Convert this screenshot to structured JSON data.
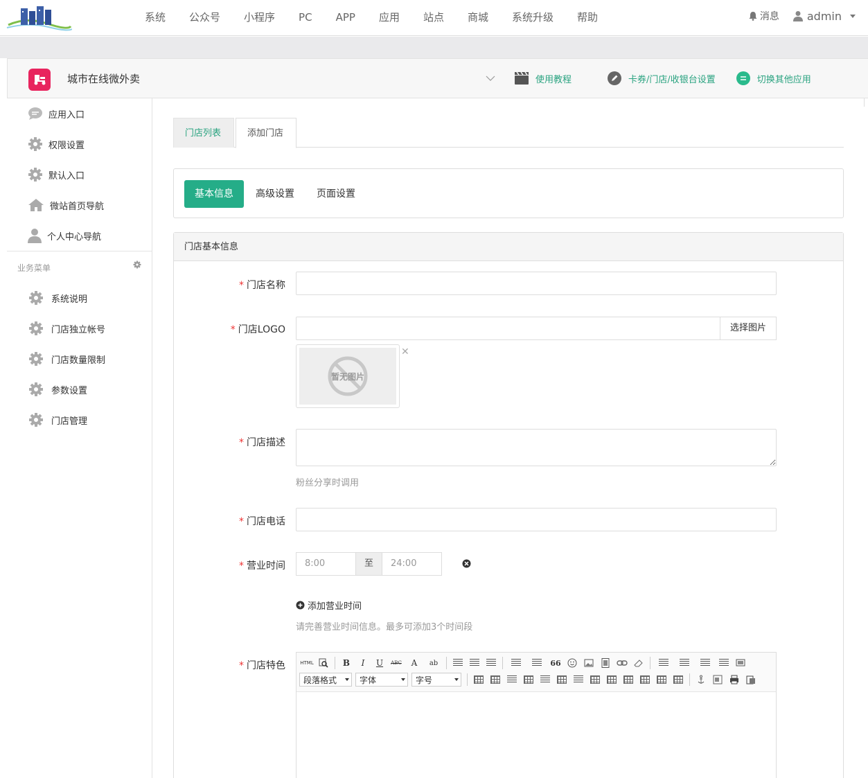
{
  "topnav": {
    "items": [
      "系统",
      "公众号",
      "小程序",
      "PC",
      "APP",
      "应用",
      "站点",
      "商城",
      "系统升级",
      "帮助"
    ],
    "message_label": "消息",
    "user_label": "admin"
  },
  "app": {
    "title": "城市在线微外卖",
    "links": {
      "tutorial": "使用教程",
      "card_settings": "卡券/门店/收银台设置",
      "switch_app": "切换其他应用"
    }
  },
  "sidebar": {
    "items": [
      "应用入口",
      "权限设置",
      "默认入口",
      "微站首页导航",
      "个人中心导航"
    ],
    "section_title": "业务菜单",
    "business_items": [
      "系统说明",
      "门店独立帐号",
      "门店数量限制",
      "参数设置",
      "门店管理"
    ]
  },
  "tabs": {
    "list": "门店列表",
    "add": "添加门店"
  },
  "subtabs": {
    "basic": "基本信息",
    "advanced": "高级设置",
    "page": "页面设置"
  },
  "form": {
    "panel_title": "门店基本信息",
    "name_label": "门店名称",
    "logo_label": "门店LOGO",
    "pick_image": "选择图片",
    "no_image": "暂无图片",
    "desc_label": "门店描述",
    "desc_help": "粉丝分享时调用",
    "phone_label": "门店电话",
    "hours_label": "营业时间",
    "hours_start": "8:00",
    "hours_to": "至",
    "hours_end": "24:00",
    "add_hours": "添加营业时间",
    "hours_help": "请完善营业时间信息。最多可添加3个时间段",
    "feature_label": "门店特色"
  },
  "editor": {
    "html_label": "HTML",
    "bold": "B",
    "italic": "I",
    "underline": "U",
    "strike": "ABC",
    "font_color": "A",
    "highlight": "ab",
    "quote": "66",
    "paragraph_select": "段落格式",
    "font_select": "字体",
    "size_select": "字号"
  },
  "colors": {
    "accent": "#25ad88",
    "link": "#2aa380",
    "required": "#e33333",
    "app_icon": "#e8245e"
  }
}
